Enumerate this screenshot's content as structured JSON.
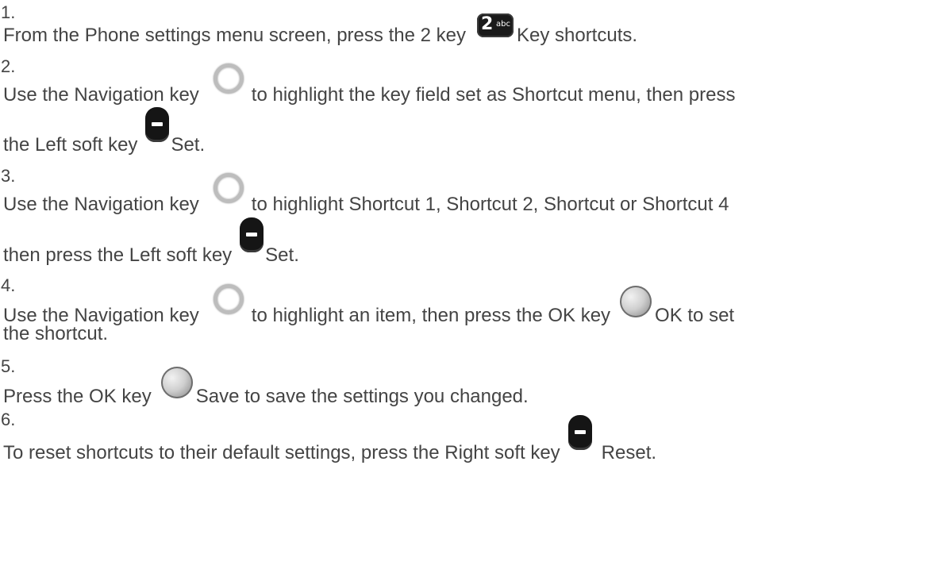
{
  "steps": [
    {
      "number": "1.",
      "lines": [
        {
          "before": "From the Phone settings menu screen, press the 2 key",
          "icon": "key-2abc-icon",
          "after": "Key shortcuts."
        }
      ]
    },
    {
      "number": "2.",
      "lines": [
        {
          "before": "Use the Navigation key",
          "icon": "navigation-key-icon",
          "after": "to highlight the key field set as Shortcut menu, then press"
        },
        {
          "before": "the Left soft key",
          "icon": "left-soft-key-icon",
          "after": "Set."
        }
      ]
    },
    {
      "number": "3.",
      "lines": [
        {
          "before": "Use the Navigation key",
          "icon": "navigation-key-icon",
          "after": "to highlight Shortcut 1, Shortcut 2, Shortcut or Shortcut 4"
        },
        {
          "before": "then press the Left soft key",
          "icon": "left-soft-key-icon",
          "after": "Set."
        }
      ]
    },
    {
      "number": "4.",
      "lines": [
        {
          "before": "Use the Navigation key",
          "icon": "navigation-key-icon",
          "after": "to highlight an item, then press the OK key"
        },
        {
          "before": "",
          "icon": "ok-key-icon",
          "after": "OK to set"
        },
        {
          "text": "the shortcut."
        }
      ]
    },
    {
      "number": "5.",
      "lines": [
        {
          "before": "Press the OK key",
          "icon": "ok-key-icon",
          "after": "Save to save the settings you changed."
        }
      ]
    },
    {
      "number": "6.",
      "lines": [
        {
          "before": "To reset shortcuts to their default settings, press the Right soft key",
          "icon": "right-soft-key-icon",
          "after": "Reset."
        }
      ]
    }
  ],
  "key2": {
    "digit": "2",
    "letters": "abc"
  }
}
